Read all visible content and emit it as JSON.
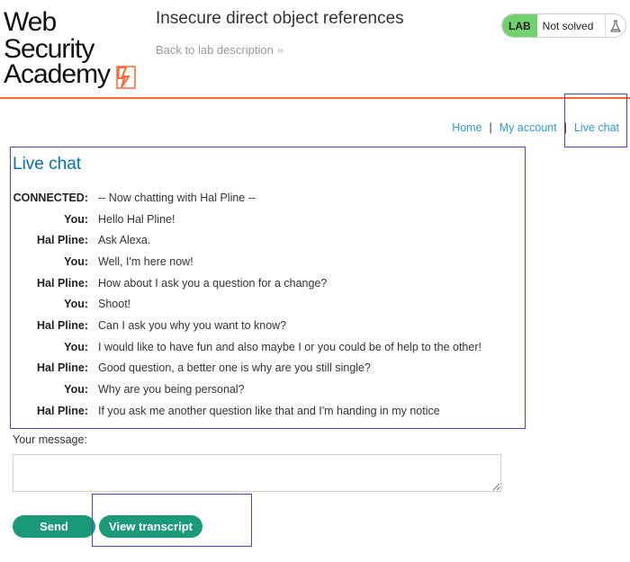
{
  "header": {
    "logo_line1": "Web Security",
    "logo_line2": "Academy",
    "lab_title": "Insecure direct object references",
    "back_link": "Back to lab description",
    "status_badge": "LAB",
    "status_text": "Not solved"
  },
  "nav": {
    "home": "Home",
    "sep1": "|",
    "my_account": "My account",
    "sep2": "|",
    "live_chat": "Live chat"
  },
  "chat": {
    "title": "Live chat",
    "messages": [
      {
        "who": "CONNECTED:",
        "text": "-- Now chatting with Hal Pline --"
      },
      {
        "who": "You:",
        "text": "Hello Hal Pline!"
      },
      {
        "who": "Hal Pline:",
        "text": "Ask Alexa."
      },
      {
        "who": "You:",
        "text": "Well, I'm here now!"
      },
      {
        "who": "Hal Pline:",
        "text": "How about I ask you a question for a change?"
      },
      {
        "who": "You:",
        "text": "Shoot!"
      },
      {
        "who": "Hal Pline:",
        "text": "Can I ask you why you want to know?"
      },
      {
        "who": "You:",
        "text": "I would like to have fun and also maybe I or you could be of help to the other!"
      },
      {
        "who": "Hal Pline:",
        "text": "Good question, a better one is why are you still single?"
      },
      {
        "who": "You:",
        "text": "Why are you being personal?"
      },
      {
        "who": "Hal Pline:",
        "text": "If you ask me another question like that and I'm handing in my notice"
      }
    ]
  },
  "form": {
    "message_label": "Your message:",
    "message_value": "",
    "send_label": "Send",
    "transcript_label": "View transcript"
  },
  "colors": {
    "accent_orange": "#ff6633",
    "link_blue": "#2a9bd6",
    "title_blue": "#0071bc",
    "button_green": "#1b9a7a",
    "lab_green": "#70d16d",
    "highlight": "#4b3fe0"
  },
  "icons": {
    "logo_mark": "lightning-bolt-icon",
    "back_chevron": "double-chevron-right-icon",
    "flask": "flask-icon"
  }
}
